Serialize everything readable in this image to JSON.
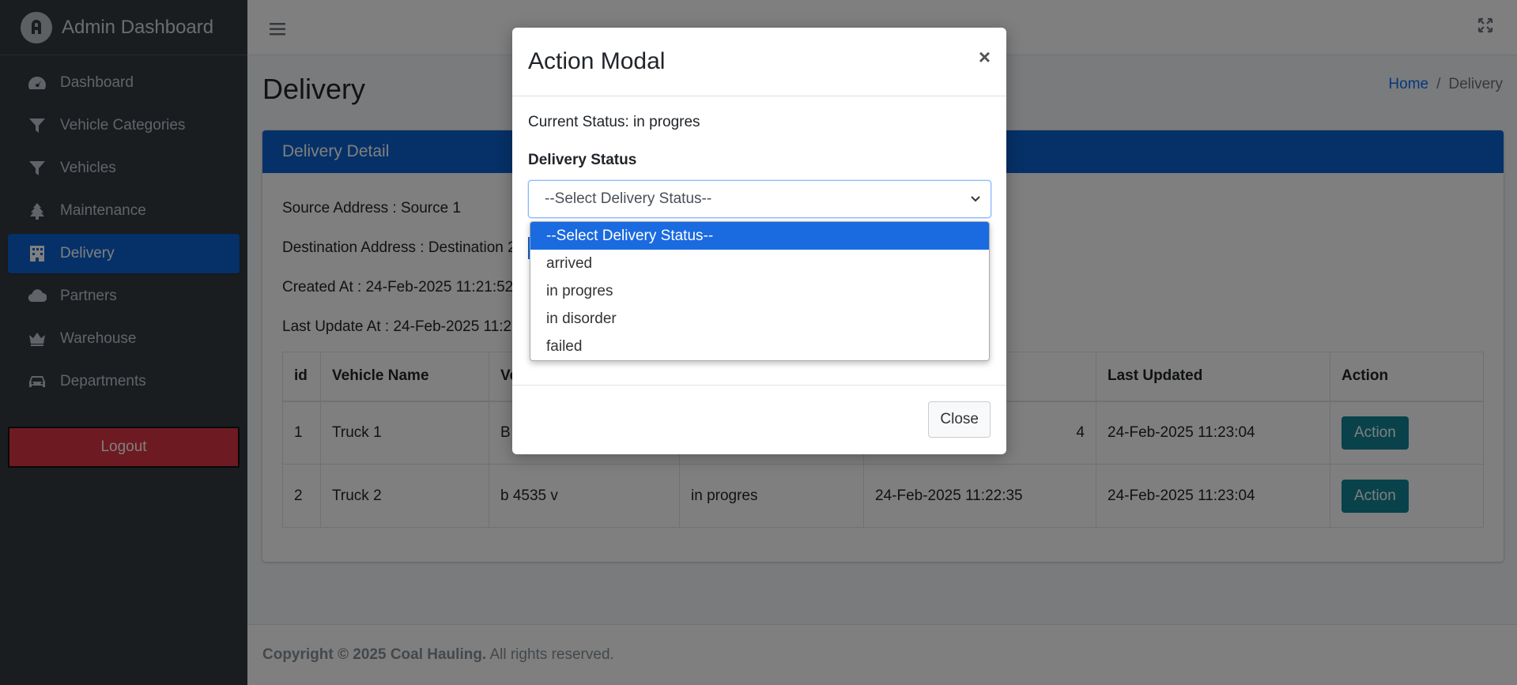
{
  "sidebar": {
    "brand": "Admin Dashboard",
    "items": [
      {
        "label": "Dashboard",
        "icon": "gauge-icon"
      },
      {
        "label": "Vehicle Categories",
        "icon": "filter-icon"
      },
      {
        "label": "Vehicles",
        "icon": "filter-icon"
      },
      {
        "label": "Maintenance",
        "icon": "tree-icon"
      },
      {
        "label": "Delivery",
        "icon": "building-icon"
      },
      {
        "label": "Partners",
        "icon": "cloud-icon"
      },
      {
        "label": "Warehouse",
        "icon": "crown-icon"
      },
      {
        "label": "Departments",
        "icon": "car-icon"
      }
    ],
    "logout": "Logout"
  },
  "header": {
    "page_title": "Delivery",
    "breadcrumb": {
      "home": "Home",
      "separator": "/",
      "current": "Delivery"
    }
  },
  "card": {
    "title": "Delivery Detail",
    "source": "Source Address : Source 1",
    "destination": "Destination Address : Destination 2",
    "created": "Created At : 24-Feb-2025 11:21:52",
    "updated": "Last Update At : 24-Feb-2025 11:21:"
  },
  "table": {
    "headers": [
      "id",
      "Vehicle Name",
      "Ve",
      "",
      "",
      "Last Updated",
      "Action"
    ],
    "rows": [
      {
        "id": "1",
        "vehicle": "Truck 1",
        "plate": "B",
        "status": "",
        "created": "4",
        "updated": "24-Feb-2025 11:23:04",
        "action": "Action"
      },
      {
        "id": "2",
        "vehicle": "Truck 2",
        "plate": "b 4535 v",
        "status": "in progres",
        "created": "24-Feb-2025 11:22:35",
        "updated": "24-Feb-2025 11:23:04",
        "action": "Action"
      }
    ]
  },
  "footer": {
    "bold": "Copyright © 2025 Coal Hauling.",
    "rest": " All rights reserved."
  },
  "modal": {
    "title": "Action Modal",
    "close_x": "×",
    "current_status": "Current Status: in progres",
    "field_label": "Delivery Status",
    "select_value": "--Select Delivery Status--",
    "options": [
      "--Select Delivery Status--",
      "arrived",
      "in progres",
      "in disorder",
      "failed"
    ],
    "close_button": "Close"
  }
}
